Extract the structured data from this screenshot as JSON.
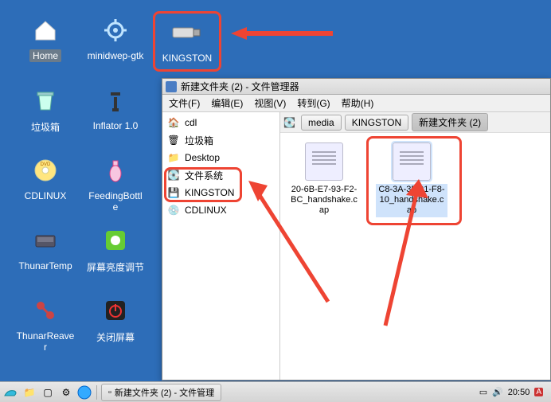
{
  "desktop": {
    "icons": [
      {
        "label": "Home"
      },
      {
        "label": "minidwep-gtk"
      },
      {
        "label": "KINGSTON"
      },
      {
        "label": "垃圾箱"
      },
      {
        "label": "Inflator 1.0"
      },
      {
        "label": "CDLINUX"
      },
      {
        "label": "FeedingBottle"
      },
      {
        "label": "ThunarTemp"
      },
      {
        "label": "屏幕亮度调节"
      },
      {
        "label": "ThunarReaver"
      },
      {
        "label": "关闭屏幕"
      }
    ]
  },
  "window": {
    "title": "新建文件夹 (2) - 文件管理器",
    "menus": {
      "file": "文件(F)",
      "edit": "编辑(E)",
      "view": "视图(V)",
      "go": "转到(G)",
      "help": "帮助(H)"
    },
    "sidebar": [
      {
        "label": "cdl",
        "icon": "home"
      },
      {
        "label": "垃圾箱",
        "icon": "trash"
      },
      {
        "label": "Desktop",
        "icon": "folder"
      },
      {
        "label": "文件系统",
        "icon": "drive"
      },
      {
        "label": "KINGSTON",
        "icon": "drive"
      },
      {
        "label": "CDLINUX",
        "icon": "cd"
      }
    ],
    "pathbar": {
      "segments": [
        "media",
        "KINGSTON",
        "新建文件夹 (2)"
      ]
    },
    "files": [
      {
        "label": "20-6B-E7-93-F2-BC_handshake.cap"
      },
      {
        "label": "C8-3A-35-01-F8-10_handshake.cap"
      }
    ]
  },
  "taskbar": {
    "task": "新建文件夹 (2) - 文件管理",
    "clock": "20:50"
  }
}
